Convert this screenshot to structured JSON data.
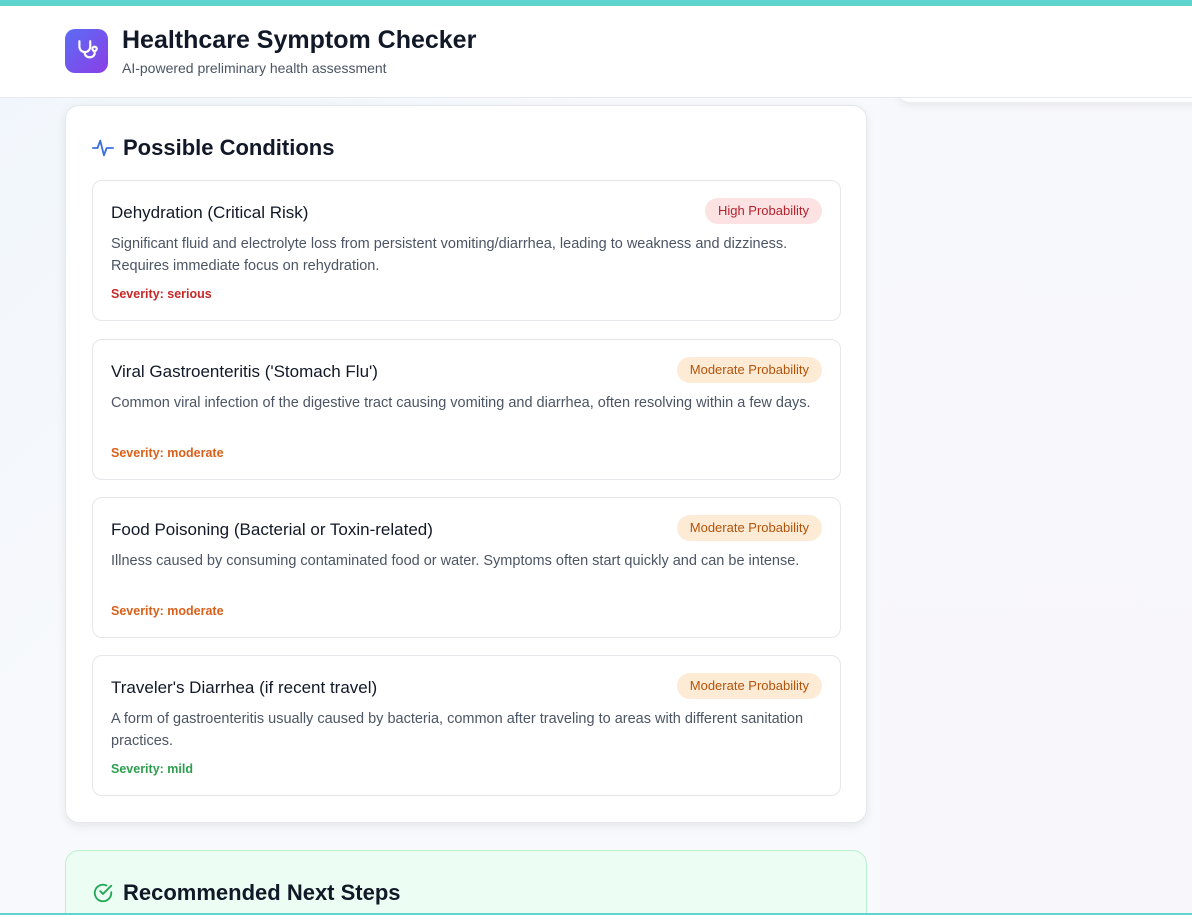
{
  "app": {
    "title": "Healthcare Symptom Checker",
    "subtitle": "AI-powered preliminary health assessment",
    "logo_icon": "stethoscope-icon"
  },
  "colors": {
    "accent_stripe": "#5fd4cf",
    "logo_gradient_start": "#5b6cf5",
    "logo_gradient_end": "#8b3fe6",
    "high_badge_bg": "#fde2e4",
    "moderate_badge_bg": "#feebd6",
    "serious": "#c62828",
    "moderate": "#d9601a",
    "mild": "#2e9e4e"
  },
  "conditions_section": {
    "title": "Possible Conditions",
    "icon": "activity-pulse-icon",
    "items": [
      {
        "name": "Dehydration (Critical Risk)",
        "probability": "High Probability",
        "description": "Significant fluid and electrolyte loss from persistent vomiting/diarrhea, leading to weakness and dizziness. Requires immediate focus on rehydration.",
        "severity": "Severity: serious"
      },
      {
        "name": "Viral Gastroenteritis ('Stomach Flu')",
        "probability": "Moderate Probability",
        "description": "Common viral infection of the digestive tract causing vomiting and diarrhea, often resolving within a few days.",
        "severity": "Severity: moderate"
      },
      {
        "name": "Food Poisoning (Bacterial or Toxin-related)",
        "probability": "Moderate Probability",
        "description": "Illness caused by consuming contaminated food or water. Symptoms often start quickly and can be intense.",
        "severity": "Severity: moderate"
      },
      {
        "name": "Traveler's Diarrhea (if recent travel)",
        "probability": "Moderate Probability",
        "description": "A form of gastroenteritis usually caused by bacteria, common after traveling to areas with different sanitation practices.",
        "severity": "Severity: mild"
      }
    ]
  },
  "next_steps_section": {
    "title": "Recommended Next Steps",
    "icon": "check-circle-icon"
  }
}
